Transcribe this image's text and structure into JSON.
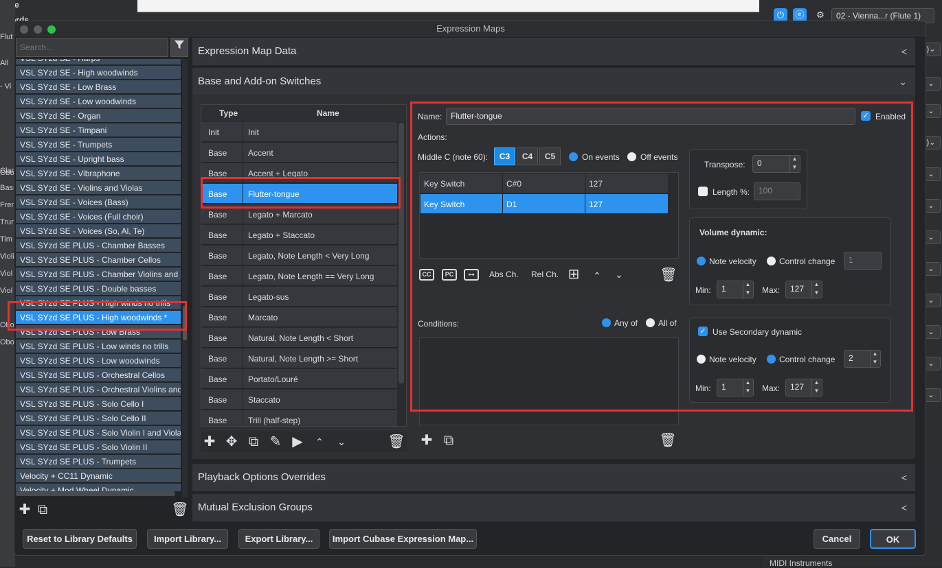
{
  "background": {
    "time_label": "Time",
    "chords_label": "Chords",
    "left_fragments": [
      "Flut",
      "All",
      "- Vi",
      "Obo",
      "Clar",
      "Bass",
      "Fren",
      "Trun",
      "Tim",
      "Violi",
      "Viol",
      "Viol",
      "Obo",
      "Obo"
    ],
    "player_name": "02 - Vienna...r (Flute 1)",
    "midi_label": "MIDI Instruments"
  },
  "dialog": {
    "title": "Expression Maps",
    "search_placeholder": "Search...",
    "maps": [
      "VSL SYzd SE - Harps",
      "VSL SYzd SE - High woodwinds",
      "VSL SYzd SE - Low Brass",
      "VSL SYzd SE - Low woodwinds",
      "VSL SYzd SE - Organ",
      "VSL SYzd SE - Timpani",
      "VSL SYzd SE - Trumpets",
      "VSL SYzd SE - Upright bass",
      "VSL SYzd SE - Vibraphone",
      "VSL SYzd SE - Violins and Violas",
      "VSL SYzd SE - Voices (Bass)",
      "VSL SYzd SE - Voices (Full choir)",
      "VSL SYzd SE - Voices (So, Al, Te)",
      "VSL SYzd SE PLUS - Chamber Basses",
      "VSL SYzd SE PLUS - Chamber Cellos",
      "VSL SYzd SE PLUS - Chamber Violins and Violas",
      "VSL SYzd SE PLUS - Double basses",
      "VSL SYzd SE PLUS - High winds no trills",
      "VSL SYzd SE PLUS - High woodwinds *",
      "VSL SYzd SE PLUS - Low Brass",
      "VSL SYzd SE PLUS - Low winds no trills",
      "VSL SYzd SE PLUS - Low woodwinds",
      "VSL SYzd SE PLUS - Orchestral Cellos",
      "VSL SYzd SE PLUS - Orchestral Violins and Violas",
      "VSL SYzd SE PLUS - Solo Cello I",
      "VSL SYzd SE PLUS - Solo Cello II",
      "VSL SYzd SE PLUS - Solo Violin I and Viola",
      "VSL SYzd SE PLUS - Solo Violin II",
      "VSL SYzd SE PLUS - Trumpets",
      "Velocity + CC11 Dynamic",
      "Velocity + Mod Wheel Dynamic"
    ],
    "selected_map_index": 18,
    "sections": {
      "expression_map_data": "Expression Map Data",
      "base_addon": "Base and Add-on Switches",
      "playback_overrides": "Playback Options Overrides",
      "mutual_exclusion": "Mutual Exclusion Groups"
    },
    "switch_table": {
      "col_type": "Type",
      "col_name": "Name",
      "rows": [
        {
          "type": "Init",
          "name": "Init"
        },
        {
          "type": "Base",
          "name": "Accent"
        },
        {
          "type": "Base",
          "name": "Accent + Legato"
        },
        {
          "type": "Base",
          "name": "Flutter-tongue"
        },
        {
          "type": "Base",
          "name": "Legato + Marcato"
        },
        {
          "type": "Base",
          "name": "Legato + Staccato"
        },
        {
          "type": "Base",
          "name": "Legato, Note Length < Very Long"
        },
        {
          "type": "Base",
          "name": "Legato, Note Length == Very Long"
        },
        {
          "type": "Base",
          "name": "Legato-sus"
        },
        {
          "type": "Base",
          "name": "Marcato"
        },
        {
          "type": "Base",
          "name": "Natural, Note Length < Short"
        },
        {
          "type": "Base",
          "name": "Natural, Note Length >= Short"
        },
        {
          "type": "Base",
          "name": "Portato/Louré"
        },
        {
          "type": "Base",
          "name": "Staccato"
        },
        {
          "type": "Base",
          "name": "Trill (half-step)"
        }
      ],
      "selected_index": 3
    },
    "details": {
      "name_label": "Name:",
      "name_value": "Flutter-tongue",
      "enabled_label": "Enabled",
      "actions_label": "Actions:",
      "middle_c_label": "Middle C (note 60):",
      "middle_c_options": [
        "C3",
        "C4",
        "C5"
      ],
      "on_events": "On events",
      "off_events": "Off events",
      "actions": [
        {
          "kind": "Key Switch",
          "value": "C#0",
          "velocity": "127"
        },
        {
          "kind": "Key Switch",
          "value": "D1",
          "velocity": "127"
        }
      ],
      "action_toolbar": {
        "cc": "CC",
        "pc": "PC",
        "abs": "Abs Ch.",
        "rel": "Rel Ch."
      },
      "transpose_label": "Transpose:",
      "transpose_value": "0",
      "length_label": "Length %:",
      "length_value": "100",
      "volume_dynamic_label": "Volume dynamic:",
      "note_velocity": "Note velocity",
      "control_change": "Control change",
      "volume_cc_value": "1",
      "min_label": "Min:",
      "max_label": "Max:",
      "vol_min": "1",
      "vol_max": "127",
      "conditions_label": "Conditions:",
      "any_of": "Any of",
      "all_of": "All of",
      "secondary_label": "Use Secondary dynamic",
      "secondary_cc_value": "2",
      "sec_min": "1",
      "sec_max": "127"
    },
    "buttons": {
      "reset": "Reset to Library Defaults",
      "import_library": "Import Library...",
      "export_library": "Export Library...",
      "import_cubase": "Import Cubase Expression Map...",
      "cancel": "Cancel",
      "ok": "OK"
    },
    "colors": {
      "accent": "#2d93ef",
      "highlight": "#e63030"
    }
  }
}
